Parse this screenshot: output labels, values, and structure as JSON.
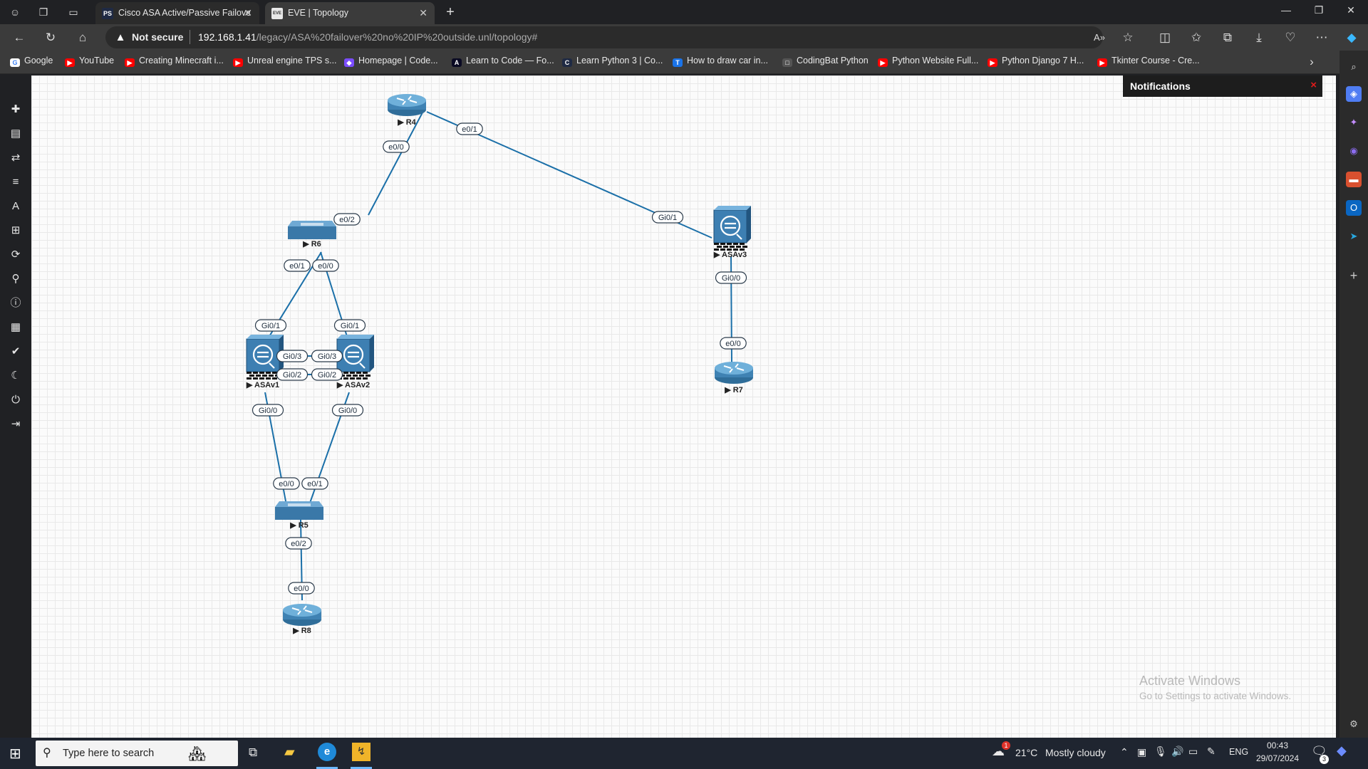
{
  "browser": {
    "tabs": [
      {
        "title": "Cisco ASA Active/Passive Failover",
        "favicon": "PS",
        "favicon_color": "#1f2a44",
        "active": false
      },
      {
        "title": "EVE | Topology",
        "favicon": "EVE",
        "favicon_color": "#e8e8e8",
        "active": true
      }
    ],
    "not_secure_label": "Not secure",
    "url_host": "192.168.1.41",
    "url_path": "/legacy/ASA%20failover%20no%20IP%20outside.unl/topology#",
    "new_tab": "+",
    "bookmarks": [
      {
        "label": "Google",
        "color": "#ffffff",
        "icon": "G"
      },
      {
        "label": "YouTube",
        "color": "#ff0000",
        "icon": "▶"
      },
      {
        "label": "Creating Minecraft i...",
        "color": "#ff0000",
        "icon": "▶"
      },
      {
        "label": "Unreal engine TPS s...",
        "color": "#ff0000",
        "icon": "▶"
      },
      {
        "label": "Homepage | Code...",
        "color": "#7b4dff",
        "icon": "◆"
      },
      {
        "label": "Learn to Code — Fo...",
        "color": "#0a0a23",
        "icon": "A"
      },
      {
        "label": "Learn Python 3 | Co...",
        "color": "#1f2a44",
        "icon": "C"
      },
      {
        "label": "How to draw car in...",
        "color": "#1a73e8",
        "icon": "T"
      },
      {
        "label": "CodingBat Python",
        "color": "#555555",
        "icon": "□"
      },
      {
        "label": "Python Website Full...",
        "color": "#ff0000",
        "icon": "▶"
      },
      {
        "label": "Python Django 7 H...",
        "color": "#ff0000",
        "icon": "▶"
      },
      {
        "label": "Tkinter Course - Cre...",
        "color": "#ff0000",
        "icon": "▶"
      }
    ]
  },
  "notifications": {
    "title": "Notifications",
    "close": "×"
  },
  "topology": {
    "nodes": [
      {
        "id": "R4",
        "label": "R4",
        "kind": "router"
      },
      {
        "id": "R6",
        "label": "R6",
        "kind": "switch"
      },
      {
        "id": "ASAv1",
        "label": "ASAv1",
        "kind": "firewall"
      },
      {
        "id": "ASAv2",
        "label": "ASAv2",
        "kind": "firewall"
      },
      {
        "id": "ASAv3",
        "label": "ASAv3",
        "kind": "firewall"
      },
      {
        "id": "R5",
        "label": "R5",
        "kind": "switch"
      },
      {
        "id": "R7",
        "label": "R7",
        "kind": "router"
      },
      {
        "id": "R8",
        "label": "R8",
        "kind": "router"
      }
    ],
    "links": [
      {
        "a": "R4",
        "a_if": "e0/0",
        "b": "R6",
        "b_if": "e0/2"
      },
      {
        "a": "R4",
        "a_if": "e0/1",
        "b": "ASAv3",
        "b_if": "Gi0/1"
      },
      {
        "a": "R6",
        "a_if": "e0/1",
        "b": "ASAv1",
        "b_if": "Gi0/1"
      },
      {
        "a": "R6",
        "a_if": "e0/0",
        "b": "ASAv2",
        "b_if": "Gi0/1"
      },
      {
        "a": "ASAv1",
        "a_if": "Gi0/3",
        "b": "ASAv2",
        "b_if": "Gi0/3"
      },
      {
        "a": "ASAv1",
        "a_if": "Gi0/2",
        "b": "ASAv2",
        "b_if": "Gi0/2"
      },
      {
        "a": "ASAv1",
        "a_if": "Gi0/0",
        "b": "R5",
        "b_if": "e0/0"
      },
      {
        "a": "ASAv2",
        "a_if": "Gi0/0",
        "b": "R5",
        "b_if": "e0/1"
      },
      {
        "a": "R5",
        "a_if": "e0/2",
        "b": "R8",
        "b_if": "e0/0"
      },
      {
        "a": "ASAv3",
        "a_if": "Gi0/0",
        "b": "R7",
        "b_if": "e0/0"
      }
    ]
  },
  "watermark": {
    "line1": "Activate Windows",
    "line2": "Go to Settings to activate Windows."
  },
  "taskbar": {
    "search_placeholder": "Type here to search",
    "weather_temp": "21°C",
    "weather_text": "Mostly cloudy",
    "weather_badge": "1",
    "language": "ENG",
    "time": "00:43",
    "date": "29/07/2024",
    "notification_count": "3"
  }
}
